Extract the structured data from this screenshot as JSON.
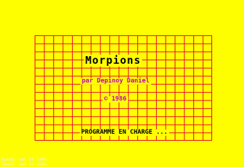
{
  "game": {
    "title": "Morpions",
    "author": "par Depinoy Daniel",
    "copyright": "© 1986",
    "loading_message": "PROGRAMME EN CHARGE ..."
  },
  "status": {
    "line1": "Speed: set to 100%",
    "line2": "Speed: set to 150%"
  },
  "colors": {
    "background": "#fefe00",
    "grid": "#e80030",
    "title": "#000000",
    "accent": "#c000c0"
  }
}
